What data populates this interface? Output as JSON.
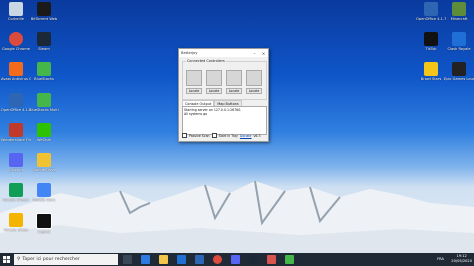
{
  "desktop_icons": [
    {
      "label": "Corbeille",
      "color": "#c9d6e3"
    },
    {
      "label": "BitTorrent Web",
      "color": "#1a1a1a"
    },
    {
      "label": "Google Chrome",
      "color": "#dd4b3e"
    },
    {
      "label": "Steam",
      "color": "#1b2838"
    },
    {
      "label": "Avast Antivirus Gratuit",
      "color": "#f26b1d"
    },
    {
      "label": "BlueStacks",
      "color": "#45b649"
    },
    {
      "label": "OpenOffice 4.1.7",
      "color": "#2f66b3"
    },
    {
      "label": "BlueStacks Multi-Instanc...",
      "color": "#45b649"
    },
    {
      "label": "Wondershare Filmora9",
      "color": "#c0392b"
    },
    {
      "label": "WeChat",
      "color": "#2dc100"
    },
    {
      "label": "Discord",
      "color": "#5865f2"
    },
    {
      "label": "Google Drive",
      "color": "#f1c232"
    },
    {
      "label": "Google Sheets",
      "color": "#0f9d58"
    },
    {
      "label": "Google Docs",
      "color": "#4285f4"
    },
    {
      "label": "Google Slides",
      "color": "#f4b400"
    },
    {
      "label": "Capcut",
      "color": "#111111"
    },
    {
      "label": "Minecraft",
      "color": "#5d8c3a"
    },
    {
      "label": "OpenOffice 4.1.7 (fr) Installation...",
      "color": "#2f66b3"
    },
    {
      "label": "TikTok",
      "color": "#111111"
    },
    {
      "label": "Clash Royale",
      "color": "#1f6fd6"
    },
    {
      "label": "Brawl Stars",
      "color": "#f5c518"
    },
    {
      "label": "Epic Games Launcher",
      "color": "#222222"
    }
  ],
  "window": {
    "title": "Betterjoy",
    "controllers_caption": "Connected Controllers",
    "locate_label": "Locate",
    "tabs": [
      "Console Output",
      "Map Buttons"
    ],
    "console_lines": [
      "Starting server on 127.0.0.1:26760.",
      "All systems go"
    ],
    "passive_scan": "Passive Scan",
    "start_in_tray": "Start in Tray",
    "donate": "Donate",
    "version": "v6.3"
  },
  "taskbar": {
    "search_placeholder": "Taper ici pour rechercher",
    "time": "19:12",
    "date": "20/05/2020",
    "lang": "FRA"
  }
}
